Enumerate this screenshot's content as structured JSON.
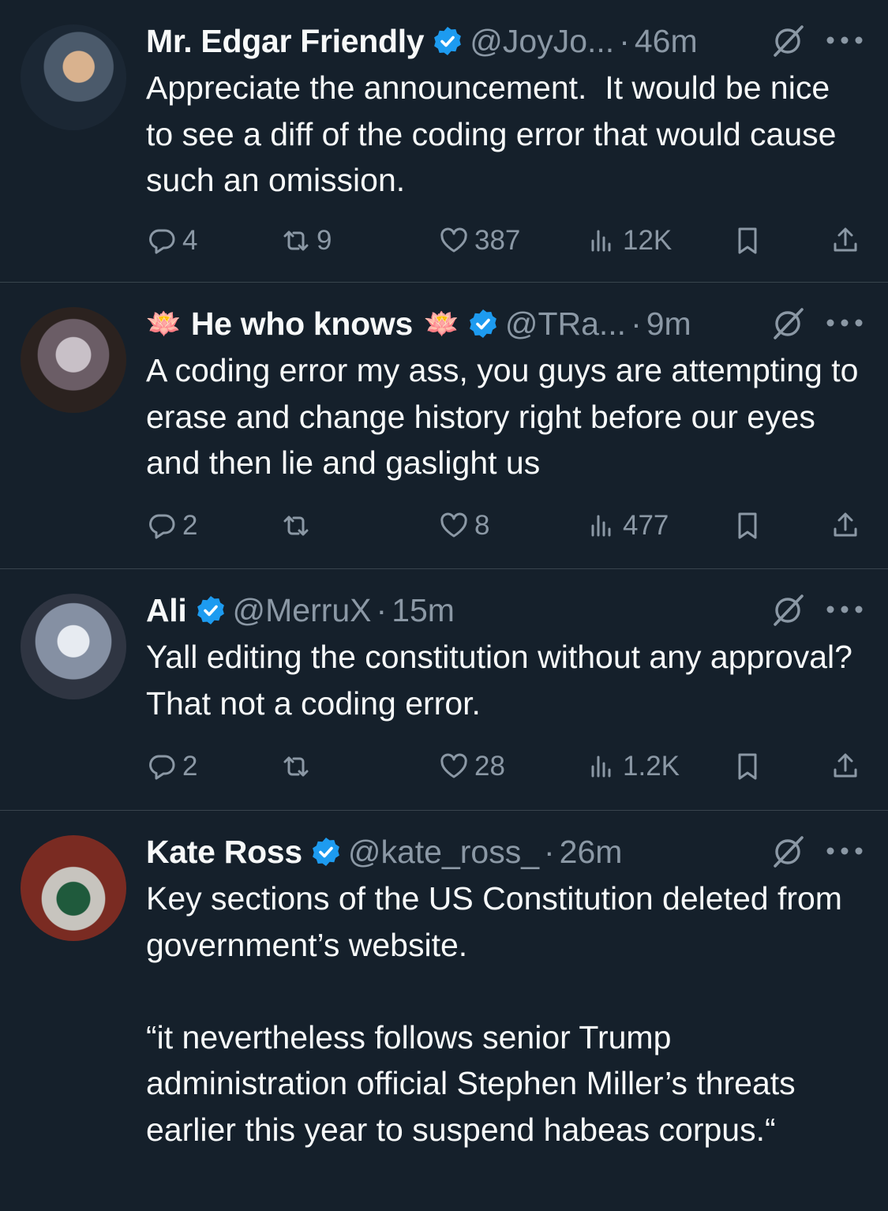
{
  "tweets": [
    {
      "name": "Mr. Edgar Friendly",
      "handle": "@JoyJo...",
      "time": "46m",
      "emoji": "",
      "text": "Appreciate the announcement.  It would be nice to see a diff of the coding error that would cause such an omission.",
      "replies": "4",
      "retweets": "9",
      "likes": "387",
      "views": "12K"
    },
    {
      "name": "He who knows",
      "handle": "@TRa...",
      "time": "9m",
      "emoji": "🪷",
      "text": "A coding error my ass, you guys are attempting to erase and change history right before our eyes and then lie and gaslight us",
      "replies": "2",
      "retweets": "",
      "likes": "8",
      "views": "477"
    },
    {
      "name": "Ali",
      "handle": "@MerruX",
      "time": "15m",
      "emoji": "",
      "text": "Yall editing the constitution without any approval? That not a coding error.",
      "replies": "2",
      "retweets": "",
      "likes": "28",
      "views": "1.2K"
    },
    {
      "name": "Kate Ross",
      "handle": "@kate_ross_",
      "time": "26m",
      "emoji": "",
      "text": "Key sections of the US Constitution deleted from government’s website.\n\n“it nevertheless follows senior Trump administration official Stephen Miller’s threats earlier this year to suspend habeas corpus.“",
      "replies": "",
      "retweets": "",
      "likes": "",
      "views": ""
    }
  ],
  "separator": "·",
  "colors": {
    "background": "#15202b",
    "text": "#f7f9f9",
    "muted": "#8b98a5",
    "verified": "#1d9bf0",
    "divider": "#38444d"
  },
  "icons": [
    "verified-badge-icon",
    "grok-icon",
    "more-icon",
    "reply-icon",
    "retweet-icon",
    "like-icon",
    "views-icon",
    "bookmark-icon",
    "share-icon",
    "lotus-emoji"
  ]
}
